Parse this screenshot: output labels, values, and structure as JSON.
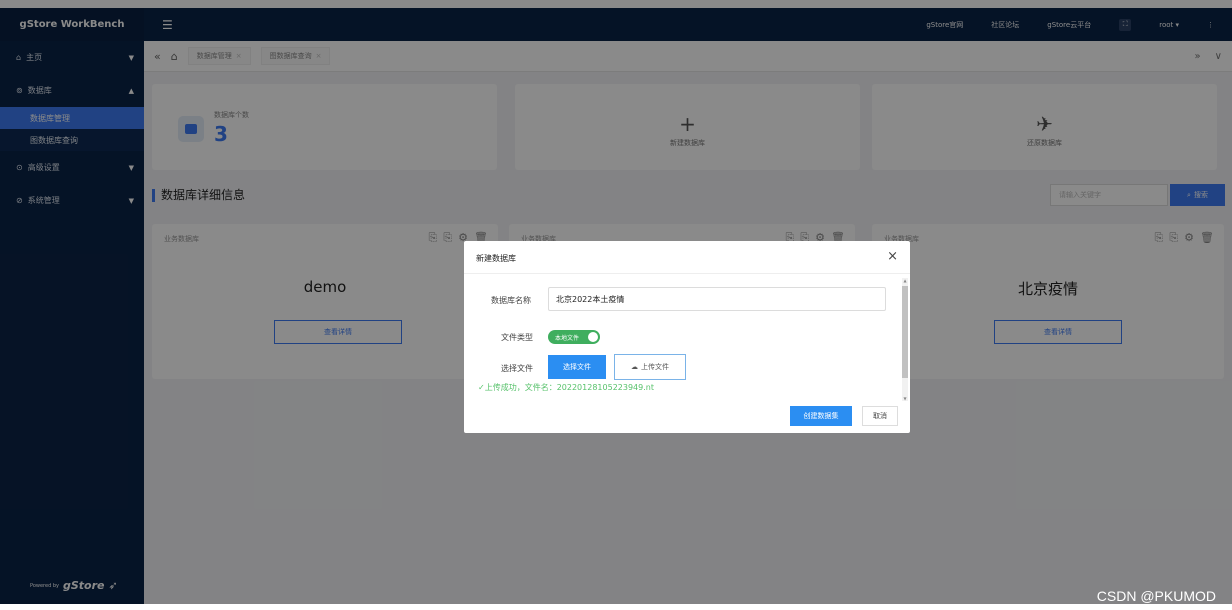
{
  "sidebar": {
    "brand": "gStore WorkBench",
    "items": [
      {
        "icon": "home-icon",
        "label": "主页",
        "caret": "▼"
      },
      {
        "icon": "database-icon",
        "label": "数据库",
        "caret": "▲"
      },
      {
        "icon": "settings-icon",
        "label": "高级设置",
        "caret": "▼"
      },
      {
        "icon": "system-icon",
        "label": "系统管理",
        "caret": "▼"
      }
    ],
    "sub_items": [
      {
        "label": "数据库管理",
        "active": true
      },
      {
        "label": "图数据库查询",
        "active": false
      }
    ],
    "powered_by": "Powered by",
    "logo_text": "gStore"
  },
  "topbar": {
    "menu_icon": "☰",
    "links": [
      "gStore官网",
      "社区论坛",
      "gStore云平台"
    ],
    "user": "root ▾",
    "more": "⋮"
  },
  "tabsbar": {
    "collapse": "«",
    "home": "⌂",
    "tabs": [
      "数据库管理",
      "图数据库查询"
    ],
    "close": "×",
    "expand": "»",
    "dropdown": "∨"
  },
  "stats": {
    "label": "数据库个数",
    "value": "3",
    "new_symbol": "+",
    "new_label": "新建数据库",
    "restore_symbol": "✈",
    "restore_label": "还原数据库"
  },
  "section": {
    "title": "数据库详细信息",
    "search_placeholder": "请输入关键字",
    "search_button": "搜索"
  },
  "cards": [
    {
      "category": "业务数据库",
      "name": "demo",
      "detail": "查看详情"
    },
    {
      "category": "业务数据库",
      "name": "",
      "detail": ""
    },
    {
      "category": "业务数据库",
      "name": "北京疫情",
      "detail": "查看详情"
    }
  ],
  "card_tools": [
    "⎘",
    "⎘",
    "⚙",
    "🗑"
  ],
  "dialog": {
    "title": "新建数据库",
    "close": "×",
    "name_label": "数据库名称",
    "name_value": "北京2022本土疫情",
    "type_label": "文件类型",
    "toggle_text": "本地文件",
    "file_label": "选择文件",
    "choose_button": "选择文件",
    "upload_button": "上传文件",
    "success_text": "✓上传成功，文件名：20220128105223949.nt",
    "create_button": "创建数据集",
    "cancel_button": "取消"
  },
  "watermark": "CSDN @PKUMOD",
  "colors": {
    "navy": "#0b2447",
    "accent": "#3d7bf2",
    "success": "#57c26b"
  }
}
